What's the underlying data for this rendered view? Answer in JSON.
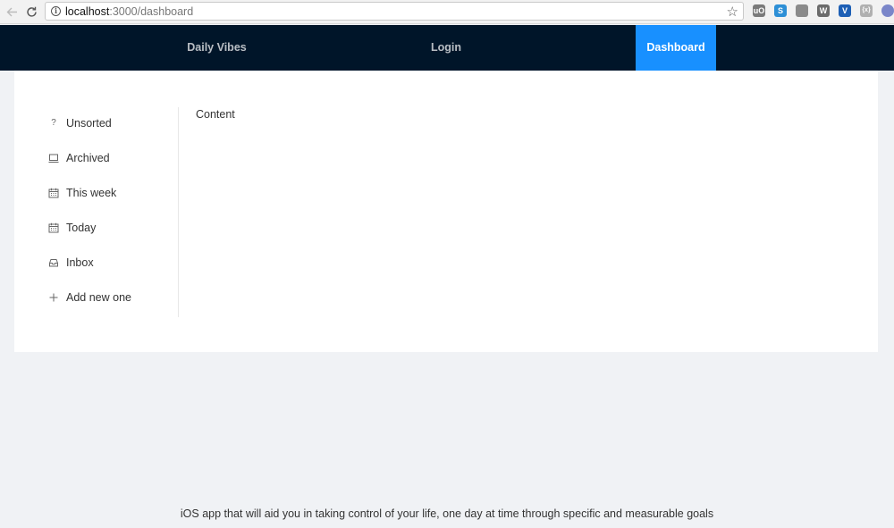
{
  "browser": {
    "url_host": "localhost",
    "url_path": ":3000/dashboard",
    "extensions": [
      {
        "name": "ublock-icon",
        "label": "uO",
        "color": "#7a7a7a"
      },
      {
        "name": "skype-icon",
        "label": "S",
        "color": "#2d8fd6"
      },
      {
        "name": "shoe-icon",
        "label": "",
        "color": "#8a8a8a"
      },
      {
        "name": "wappalyzer-icon",
        "label": "W",
        "color": "#6b6b6b"
      },
      {
        "name": "vue-icon",
        "label": "V",
        "color": "#1d5fb5"
      },
      {
        "name": "json-icon",
        "label": "{x}",
        "color": "#b0b0b0"
      },
      {
        "name": "profile-icon",
        "label": "",
        "color": "#7a86c9"
      }
    ]
  },
  "nav": {
    "brand": "Daily Vibes",
    "login": "Login",
    "dashboard": "Dashboard"
  },
  "sidebar": {
    "items": [
      {
        "label": "Unsorted",
        "icon": "question-icon"
      },
      {
        "label": "Archived",
        "icon": "laptop-icon"
      },
      {
        "label": "This week",
        "icon": "calendar-icon"
      },
      {
        "label": "Today",
        "icon": "calendar-icon"
      },
      {
        "label": "Inbox",
        "icon": "inbox-icon"
      },
      {
        "label": "Add new one",
        "icon": "plus-icon"
      }
    ]
  },
  "main": {
    "content": "Content"
  },
  "footer": {
    "text": "iOS app that will aid you in taking control of your life, one day at time through specific and measurable goals"
  },
  "colors": {
    "nav_bg": "#001529",
    "accent": "#1890ff",
    "page_bg": "#f0f2f5"
  }
}
